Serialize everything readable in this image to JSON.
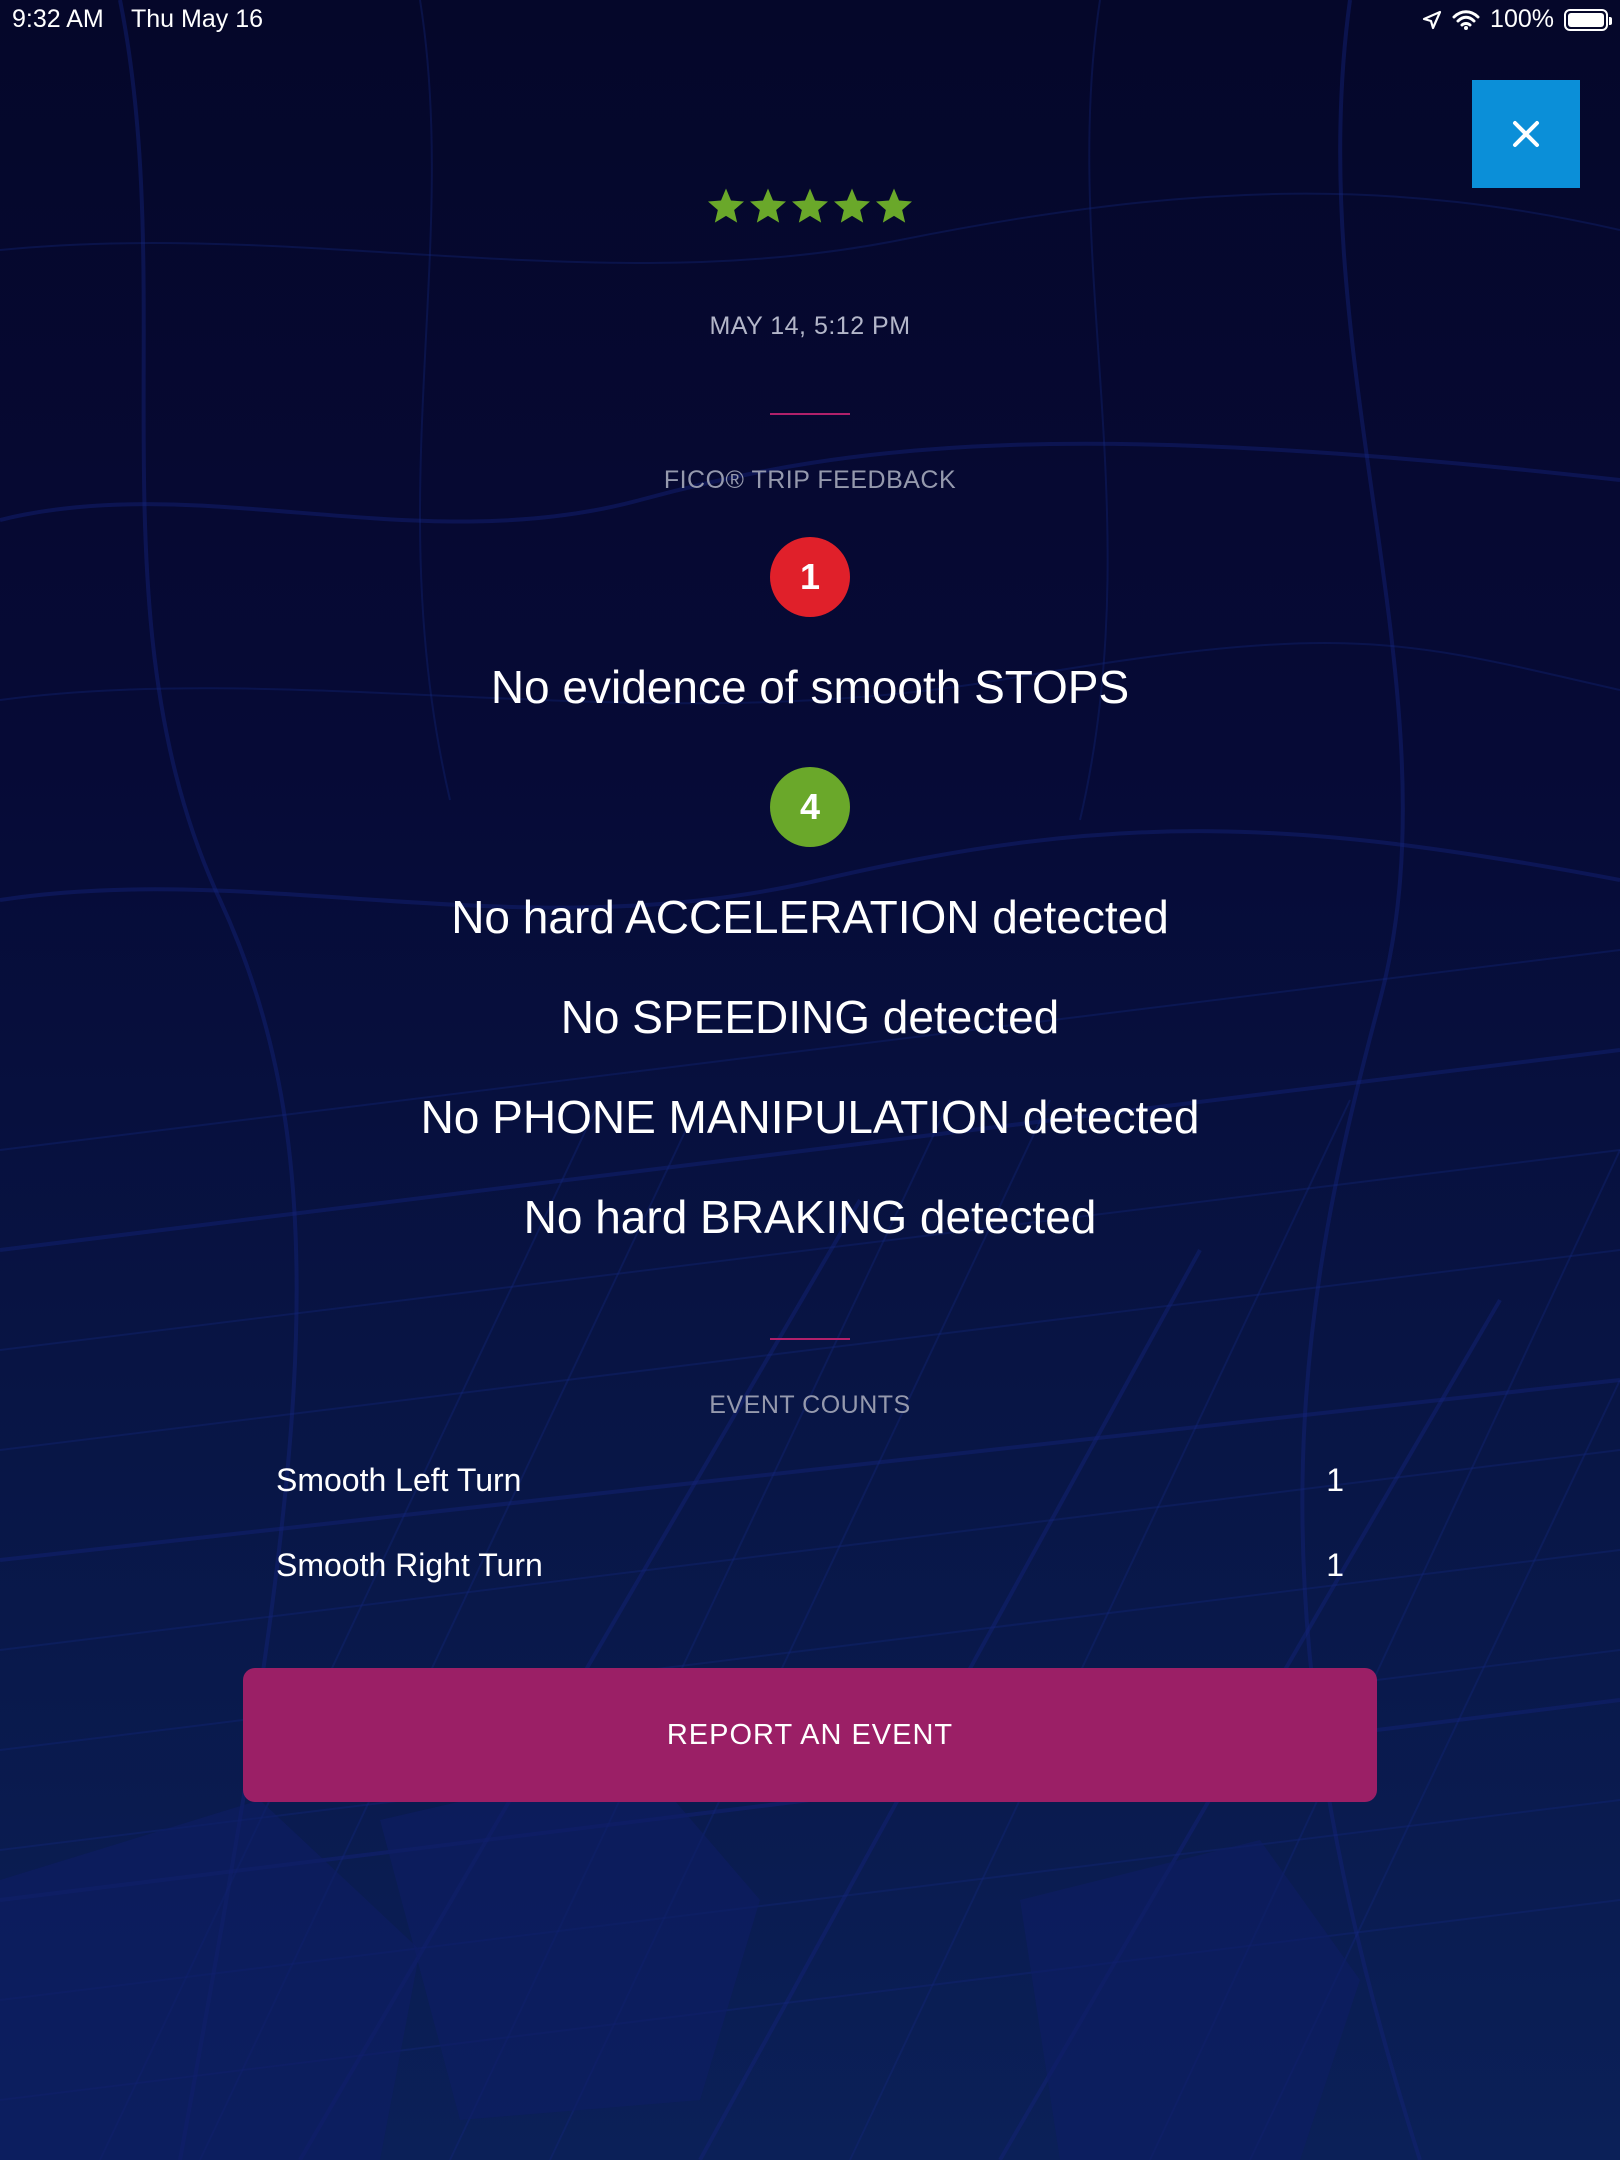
{
  "status_bar": {
    "time": "9:32 AM",
    "date": "Thu May 16",
    "battery": "100%",
    "icons": [
      "location-arrow-icon",
      "wifi-icon",
      "battery-icon"
    ]
  },
  "close_button": {
    "icon": "close-icon",
    "color": "#0b8fd8"
  },
  "rating": {
    "stars": 5,
    "max": 5,
    "color": "#6aa82a"
  },
  "trip": {
    "date": "MAY 14, 5:12 PM"
  },
  "feedback": {
    "section_title": "FICO® TRIP FEEDBACK",
    "negative": {
      "count": "1",
      "color": "#e0202a",
      "items": [
        "No evidence of smooth STOPS"
      ]
    },
    "positive": {
      "count": "4",
      "color": "#6aa82a",
      "items": [
        "No hard ACCELERATION detected",
        "No SPEEDING detected",
        "No PHONE MANIPULATION detected",
        "No hard BRAKING detected"
      ]
    }
  },
  "event_counts": {
    "title": "EVENT COUNTS",
    "rows": [
      {
        "name": "Smooth Left Turn",
        "count": "1"
      },
      {
        "name": "Smooth Right Turn",
        "count": "1"
      }
    ]
  },
  "report_button": {
    "label": "REPORT AN EVENT",
    "color": "#9b1f66"
  },
  "colors": {
    "accent_divider": "#b0206a",
    "background": "#05072a"
  }
}
